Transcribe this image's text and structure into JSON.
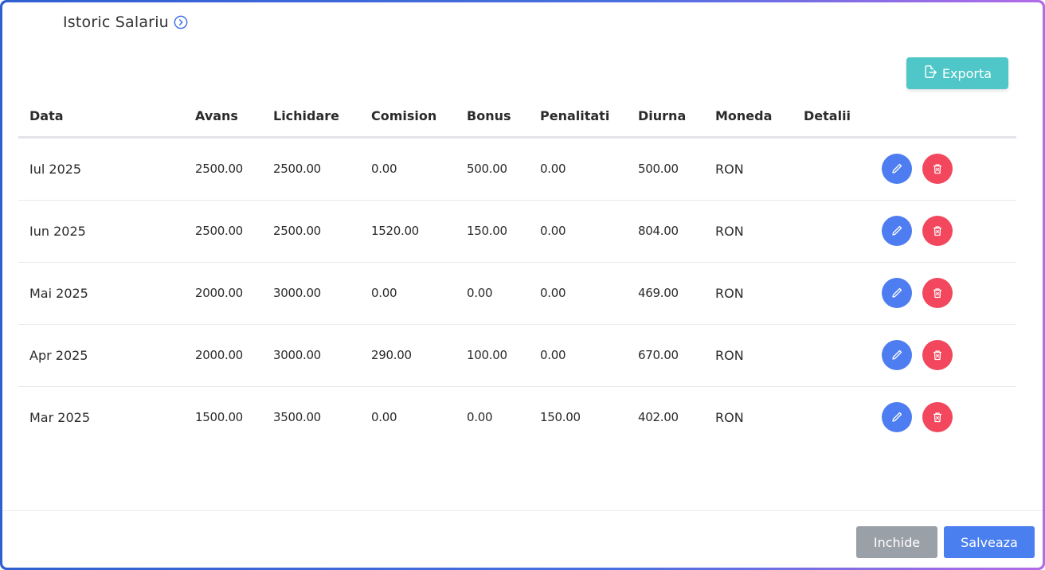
{
  "modal": {
    "title": "Istoric Salariu",
    "title_icon": "chevron-right-circle-icon",
    "border_gradient": [
      "#2f5fd0",
      "#b46be8"
    ]
  },
  "toolbar": {
    "export_label": "Exporta",
    "export_icon": "file-export-icon",
    "export_color": "#4fc6c8"
  },
  "table": {
    "headers": [
      "Data",
      "Avans",
      "Lichidare",
      "Comision",
      "Bonus",
      "Penalitati",
      "Diurna",
      "Moneda",
      "Detalii"
    ],
    "rows": [
      {
        "data": "Iul 2025",
        "avans": "2500.00",
        "lichidare": "2500.00",
        "comision": "0.00",
        "bonus": "500.00",
        "penalitati": "0.00",
        "diurna": "500.00",
        "moneda": "RON",
        "detalii": ""
      },
      {
        "data": "Iun 2025",
        "avans": "2500.00",
        "lichidare": "2500.00",
        "comision": "1520.00",
        "bonus": "150.00",
        "penalitati": "0.00",
        "diurna": "804.00",
        "moneda": "RON",
        "detalii": ""
      },
      {
        "data": "Mai 2025",
        "avans": "2000.00",
        "lichidare": "3000.00",
        "comision": "0.00",
        "bonus": "0.00",
        "penalitati": "0.00",
        "diurna": "469.00",
        "moneda": "RON",
        "detalii": ""
      },
      {
        "data": "Apr 2025",
        "avans": "2000.00",
        "lichidare": "3000.00",
        "comision": "290.00",
        "bonus": "100.00",
        "penalitati": "0.00",
        "diurna": "670.00",
        "moneda": "RON",
        "detalii": ""
      },
      {
        "data": "Mar 2025",
        "avans": "1500.00",
        "lichidare": "3500.00",
        "comision": "0.00",
        "bonus": "0.00",
        "penalitati": "150.00",
        "diurna": "402.00",
        "moneda": "RON",
        "detalii": ""
      }
    ],
    "row_actions": {
      "edit_icon": "pencil-icon",
      "edit_color": "#4d7df0",
      "delete_icon": "trash-icon",
      "delete_color": "#f2475c"
    }
  },
  "footer": {
    "close_label": "Inchide",
    "close_color": "#9aa0a8",
    "save_label": "Salveaza",
    "save_color": "#4a7ff0"
  }
}
